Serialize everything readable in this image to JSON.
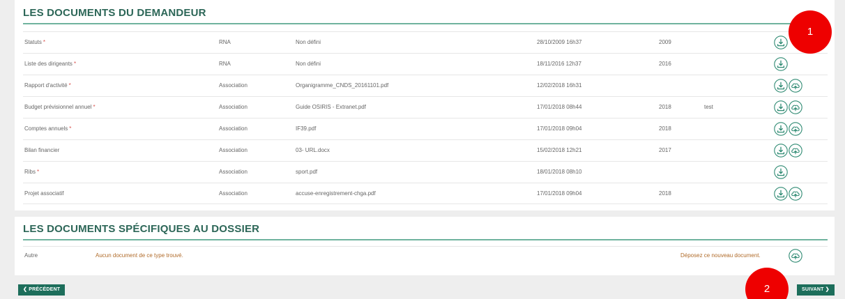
{
  "section_demandeur": {
    "title": "LES DOCUMENTS DU DEMANDEUR",
    "rows": [
      {
        "type": "Statuts",
        "required": "*",
        "source": "RNA",
        "file": "Non défini",
        "date": "28/10/2009 16h37",
        "year": "2009",
        "comment": "",
        "upload": false
      },
      {
        "type": "Liste des dirigeants",
        "required": "*",
        "source": "RNA",
        "file": "Non défini",
        "date": "18/11/2016 12h37",
        "year": "2016",
        "comment": "",
        "upload": false
      },
      {
        "type": "Rapport d'activité",
        "required": "*",
        "source": "Association",
        "file": "Organigramme_CNDS_20161101.pdf",
        "date": "12/02/2018 16h31",
        "year": "",
        "comment": "",
        "upload": true
      },
      {
        "type": "Budget prévisionnel annuel",
        "required": "*",
        "source": "Association",
        "file": "Guide OSIRIS - Extranet.pdf",
        "date": "17/01/2018 08h44",
        "year": "2018",
        "comment": "test",
        "upload": true
      },
      {
        "type": "Comptes annuels",
        "required": "*",
        "source": "Association",
        "file": "IF39.pdf",
        "date": "17/01/2018 09h04",
        "year": "2018",
        "comment": "",
        "upload": true
      },
      {
        "type": "Bilan financier",
        "required": "",
        "source": "Association",
        "file": "03- URL.docx",
        "date": "15/02/2018 12h21",
        "year": "2017",
        "comment": "",
        "upload": true
      },
      {
        "type": "Ribs",
        "required": "*",
        "source": "Association",
        "file": "sport.pdf",
        "date": "18/01/2018 08h10",
        "year": "",
        "comment": "",
        "upload": false
      },
      {
        "type": "Projet associatif",
        "required": "",
        "source": "Association",
        "file": "accuse-enregistrement-chga.pdf",
        "date": "17/01/2018 09h04",
        "year": "2018",
        "comment": "",
        "upload": true
      }
    ]
  },
  "section_specifiques": {
    "title": "LES DOCUMENTS SPÉCIFIQUES AU DOSSIER",
    "row": {
      "type": "Autre",
      "empty_message": "Aucun document de ce type trouvé.",
      "deposit_label": "Déposez ce nouveau document."
    }
  },
  "nav": {
    "prev_label": "❮ PRÉCÉDENT",
    "next_label": "SUIVANT ❯"
  },
  "markers": {
    "first": "1",
    "second": "2"
  },
  "colors": {
    "accent": "#1d6e5b",
    "title": "#2c6657",
    "rule": "#6fb39e",
    "required": "#d9534f",
    "marker": "#ee0000"
  },
  "icons": {
    "download": "download-icon",
    "upload": "cloud-upload-icon"
  }
}
